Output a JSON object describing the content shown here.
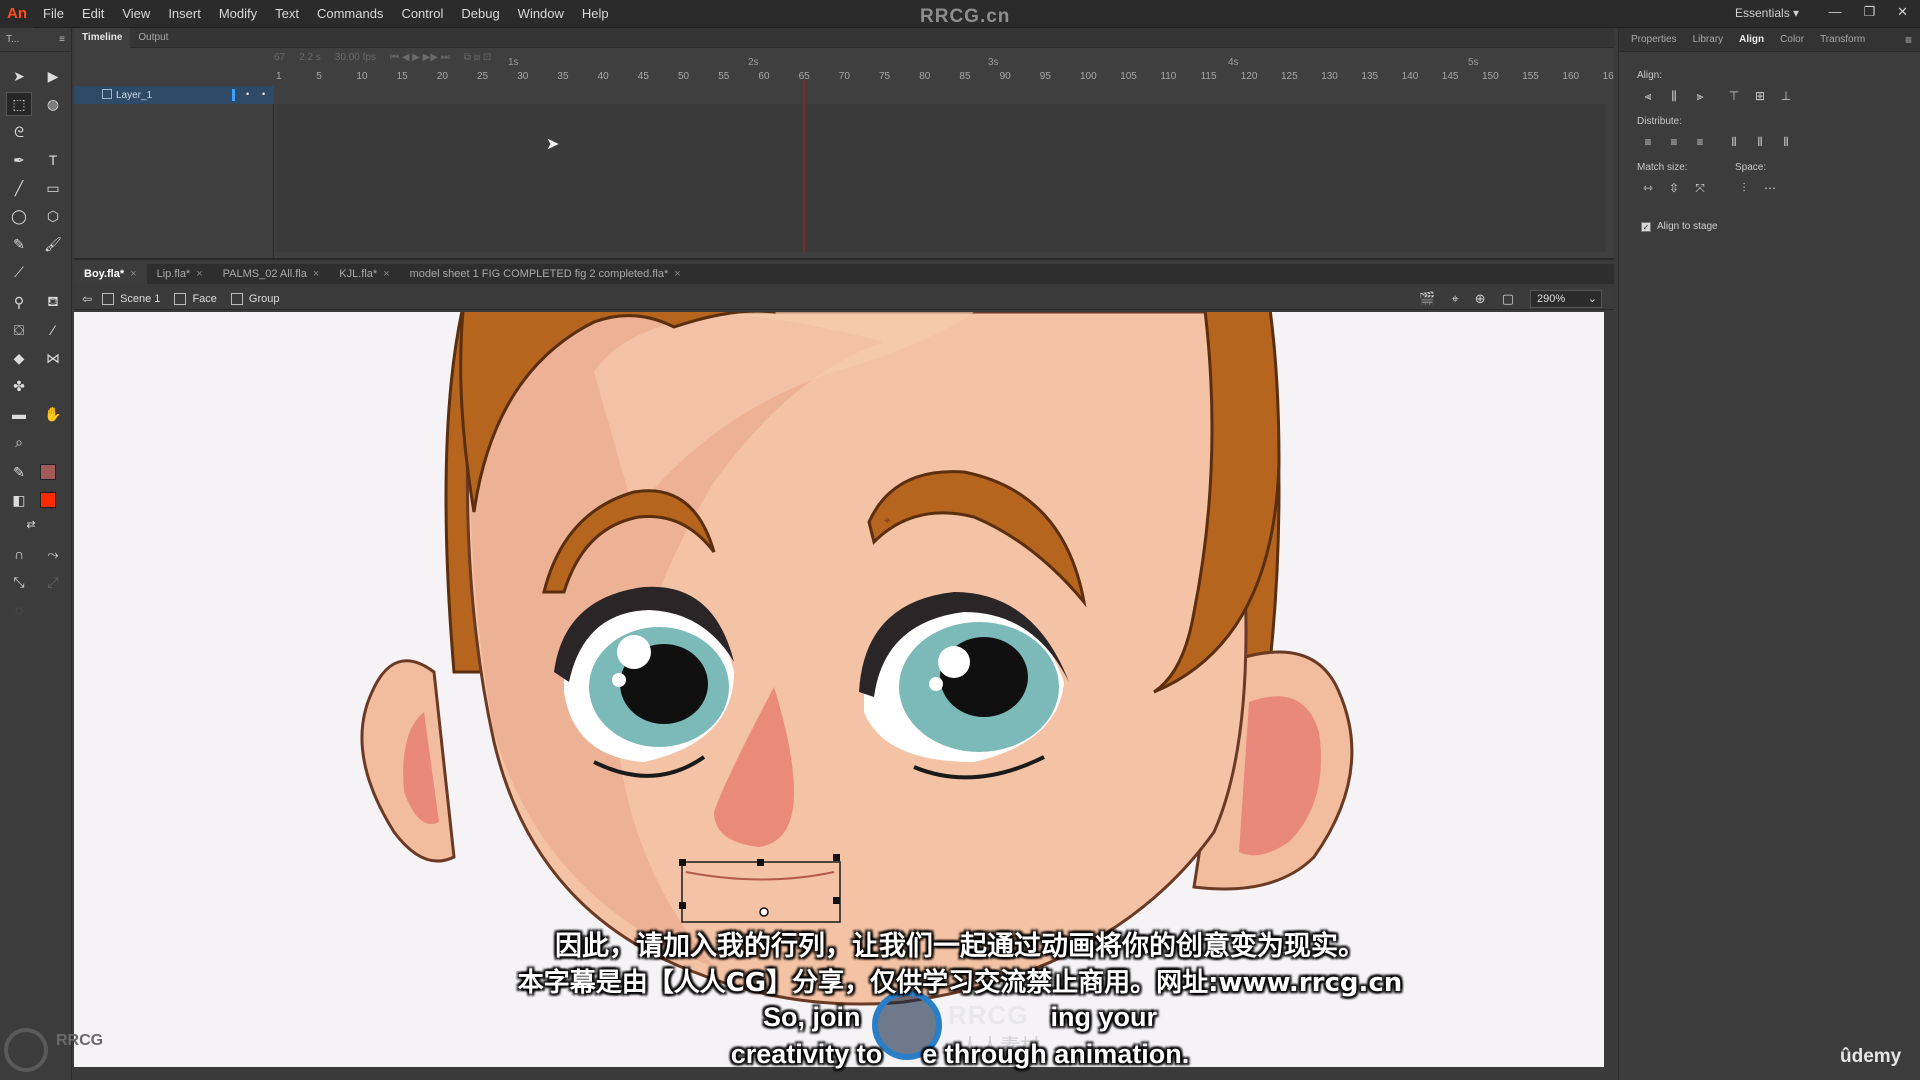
{
  "app": {
    "logo": "An",
    "watermark_title": "RRCG.cn",
    "workspace": "Essentials ▾"
  },
  "menu": [
    "File",
    "Edit",
    "View",
    "Insert",
    "Modify",
    "Text",
    "Commands",
    "Control",
    "Debug",
    "Window",
    "Help"
  ],
  "window_controls": [
    "—",
    "❐",
    "✕"
  ],
  "tools_panel": {
    "title": "T..."
  },
  "timeline": {
    "tabs": [
      "Timeline",
      "Output"
    ],
    "layer_name": "Layer_1",
    "frame_numbers": [
      "1",
      "5",
      "10",
      "15",
      "20",
      "25",
      "30",
      "35",
      "40",
      "45",
      "50",
      "55",
      "60",
      "65",
      "70",
      "75",
      "80",
      "85",
      "90",
      "95",
      "100",
      "105",
      "110",
      "115",
      "120",
      "125",
      "130",
      "135",
      "140",
      "145",
      "150",
      "155",
      "160",
      "16"
    ],
    "second_markers": [
      "1s",
      "2s",
      "3s",
      "4s",
      "5s"
    ],
    "toolbar": {
      "fps": "30.00 fps",
      "frame": "67",
      "time": "2.2 s"
    }
  },
  "documents": [
    {
      "name": "Boy.fla*",
      "close": "×"
    },
    {
      "name": "Lip.fla*",
      "close": "×"
    },
    {
      "name": "PALMS_02 All.fla",
      "close": "×"
    },
    {
      "name": "KJL.fla*",
      "close": "×"
    },
    {
      "name": "model sheet 1 FIG COMPLETED fig 2 completed.fla*",
      "close": "×"
    }
  ],
  "edit_bar": {
    "crumbs": [
      "Scene 1",
      "Face",
      "Group"
    ],
    "zoom": "290%"
  },
  "right_panel": {
    "tabs": [
      "Properties",
      "Library",
      "Align",
      "Color",
      "Transform"
    ],
    "active_tab": "Align",
    "align_label": "Align:",
    "distribute_label": "Distribute:",
    "match_size_label": "Match size:",
    "space_label": "Space:",
    "align_to_stage": "Align to stage",
    "align_to_stage_checked": true
  },
  "subtitles": {
    "cn_line1": "因此，请加入我的行列，让我们一起通过动画将你的创意变为现实。",
    "cn_line2": "本字幕是由【人人CG】分享，仅供学习交流禁止商用。网址:www.rrcg.cn",
    "en_line1": "So, join",
    "en_line1_end": "ing your",
    "en_line2": "creativity to",
    "en_line2_end": "e through animation."
  },
  "overlay": {
    "logo_text": "RRCG",
    "logo_sub": "人人素材",
    "udemy": "ûdemy",
    "corner_text": "RRCG"
  },
  "colors": {
    "hair": "#b5651d",
    "skin": "#f4c0a0",
    "shadow": "#eaa88a",
    "eye_iris": "#7bbab8",
    "nose": "#e98b78",
    "selection": "#1a1a1a"
  }
}
